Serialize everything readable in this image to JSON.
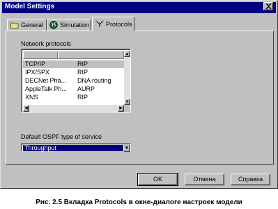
{
  "window": {
    "title": "Model Settings",
    "close_glyph": "X"
  },
  "tabs": [
    {
      "label": "General",
      "icon": "folder-icon",
      "active": false
    },
    {
      "label": "Simulation",
      "icon": "globe-icon",
      "active": false
    },
    {
      "label": "Protocols",
      "icon": "network-icon",
      "active": true
    }
  ],
  "protocols": {
    "group_label": "Network protocols",
    "rows": [
      {
        "protocol": "TCP/IP",
        "routing": "RIP",
        "selected": true
      },
      {
        "protocol": "IPX/SPX",
        "routing": "RIP",
        "selected": false
      },
      {
        "protocol": "DECNet Pha...",
        "routing": "DNA routing",
        "selected": false
      },
      {
        "protocol": "AppleTalk Ph...",
        "routing": "AURP",
        "selected": false
      },
      {
        "protocol": "XNS",
        "routing": "RIP",
        "selected": false
      }
    ]
  },
  "ospf": {
    "label": "Default OSPF type of service",
    "value": "Throughput"
  },
  "buttons": {
    "ok": "OK",
    "cancel": "Отмена",
    "help": "Справка"
  },
  "caption": "Рис. 2.5  Вкладка Protocols в окне-диалоге настроек модели",
  "colors": {
    "titlebar": "#000080",
    "face": "#c0c0c0",
    "selection": "#000080"
  }
}
